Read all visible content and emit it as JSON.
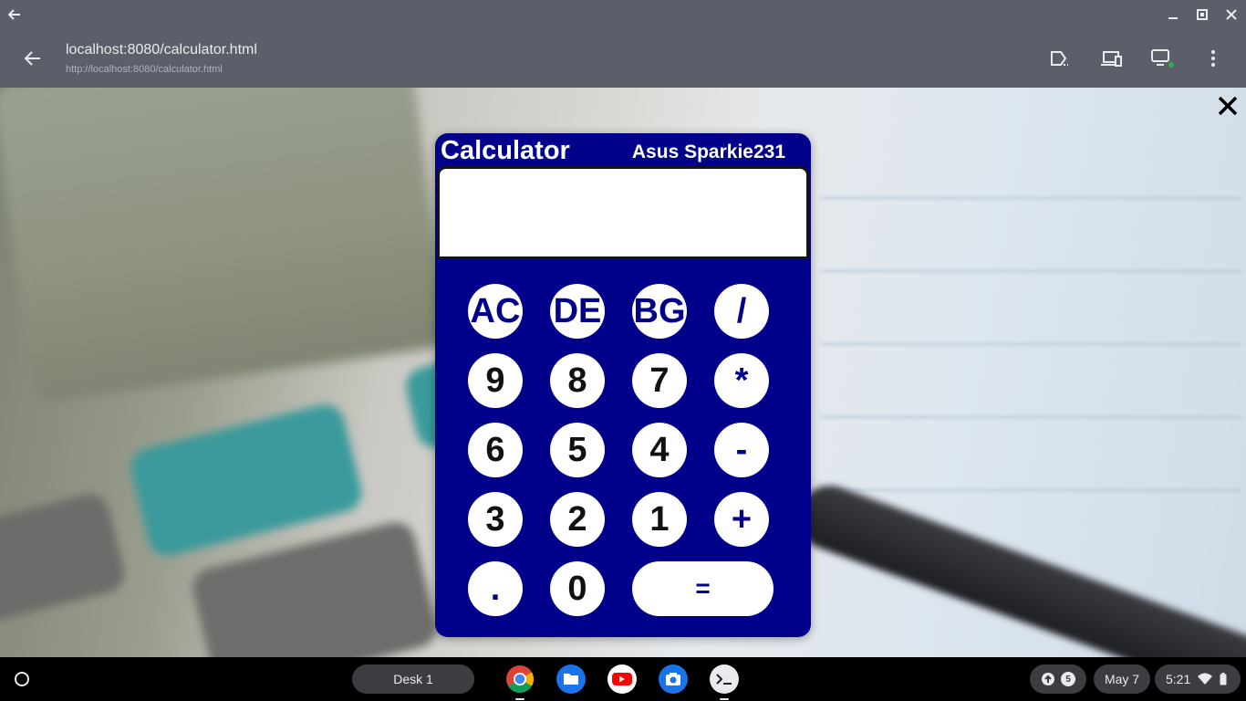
{
  "window": {
    "back_icon": "arrow-left-icon",
    "controls": [
      "minimize-icon",
      "restore-icon",
      "close-icon"
    ]
  },
  "appbar": {
    "title": "localhost:8080/calculator.html",
    "url": "http://localhost:8080/calculator.html",
    "icons": [
      "open-in-browser-icon",
      "devices-icon",
      "cast-screen-icon",
      "more-vert-icon"
    ]
  },
  "calculator": {
    "title": "Calculator",
    "brand": "Asus Sparkie231",
    "display": "",
    "keys": {
      "ac": "AC",
      "de": "DE",
      "bg": "BG",
      "divide": "/",
      "nine": "9",
      "eight": "8",
      "seven": "7",
      "multiply": "*",
      "six": "6",
      "five": "5",
      "four": "4",
      "minus": "-",
      "three": "3",
      "two": "2",
      "one": "1",
      "plus": "+",
      "dot": ".",
      "zero": "0",
      "equals": "="
    },
    "colors": {
      "body": "#00008b",
      "key": "#ffffff"
    }
  },
  "shelf": {
    "desk_label": "Desk 1",
    "apps": [
      "chrome-icon",
      "files-icon",
      "youtube-icon",
      "camera-icon",
      "terminal-icon"
    ],
    "notification_count": "5",
    "date": "May 7",
    "time": "5:21"
  }
}
